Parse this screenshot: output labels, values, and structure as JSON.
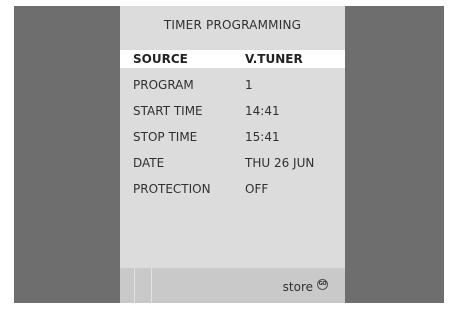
{
  "menu": {
    "title": "TIMER PROGRAMMING",
    "rows": [
      {
        "label": "SOURCE",
        "value": "V.TUNER",
        "selected": true
      },
      {
        "label": "PROGRAM",
        "value": "1",
        "selected": false
      },
      {
        "label": "START TIME",
        "value": "14:41",
        "selected": false
      },
      {
        "label": "STOP TIME",
        "value": "15:41",
        "selected": false
      },
      {
        "label": "DATE",
        "value": "THU  26 JUN",
        "selected": false
      },
      {
        "label": "PROTECTION",
        "value": "OFF",
        "selected": false
      }
    ]
  },
  "footer": {
    "store_label": "store",
    "go_icon_text": "GO"
  },
  "colors": {
    "frame_background": "#6e6e6e",
    "menu_background": "#dcdcdc",
    "selected_row_background": "#ffffff",
    "footer_background": "#c9c9c9"
  }
}
